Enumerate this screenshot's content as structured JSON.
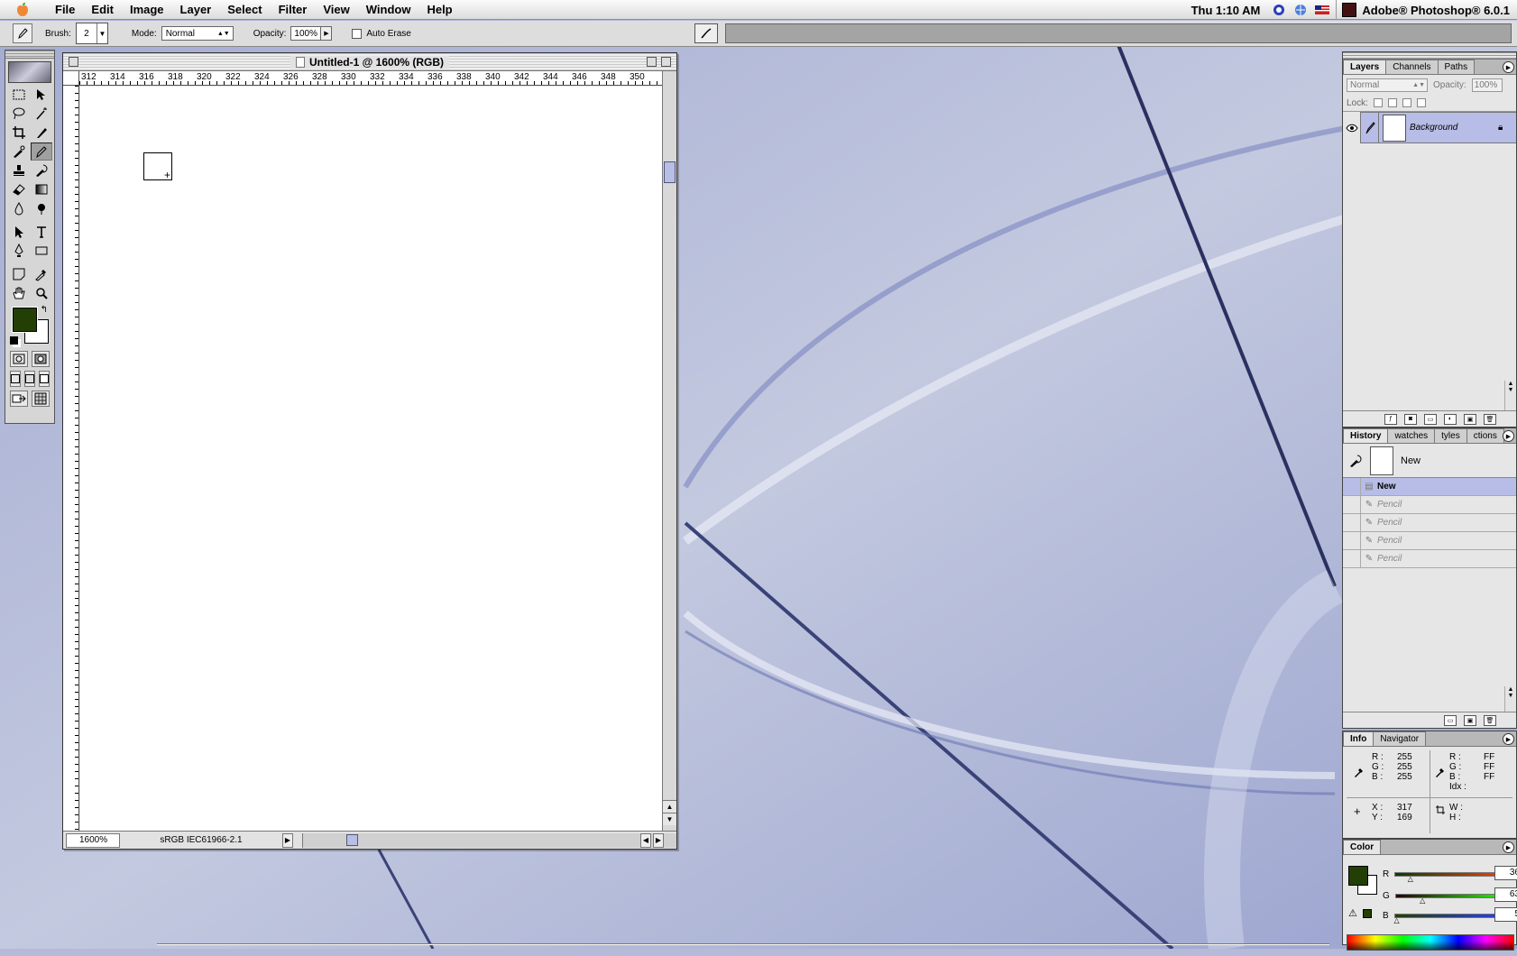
{
  "menubar": {
    "items": [
      "File",
      "Edit",
      "Image",
      "Layer",
      "Select",
      "Filter",
      "View",
      "Window",
      "Help"
    ],
    "clock": "Thu 1:10 AM",
    "app_name": "Adobe® Photoshop® 6.0.1"
  },
  "options": {
    "brush_label": "Brush:",
    "brush_size": "2",
    "mode_label": "Mode:",
    "mode_value": "Normal",
    "opacity_label": "Opacity:",
    "opacity_value": "100%",
    "auto_erase_label": "Auto Erase"
  },
  "document": {
    "title": "Untitled-1 @ 1600% (RGB)",
    "ruler_h": [
      "312",
      "314",
      "316",
      "318",
      "320",
      "322",
      "324",
      "326",
      "328",
      "330",
      "332",
      "334",
      "336",
      "338",
      "340",
      "342",
      "344",
      "346",
      "348",
      "350"
    ],
    "zoom": "1600%",
    "profile": "sRGB IEC61966-2.1"
  },
  "layers": {
    "tabs": [
      "Layers",
      "Channels",
      "Paths"
    ],
    "blend_mode": "Normal",
    "opacity_label": "Opacity:",
    "opacity_value": "100%",
    "lock_label": "Lock:",
    "items": [
      {
        "name": "Background"
      }
    ]
  },
  "history": {
    "tabs": [
      "History",
      "watches",
      "tyles",
      "ctions"
    ],
    "snapshot_name": "New",
    "items": [
      {
        "name": "New"
      },
      {
        "name": "Pencil"
      },
      {
        "name": "Pencil"
      },
      {
        "name": "Pencil"
      },
      {
        "name": "Pencil"
      }
    ]
  },
  "info": {
    "tabs": [
      "Info",
      "Navigator"
    ],
    "rgb_left": {
      "r": "255",
      "g": "255",
      "b": "255"
    },
    "rgb_right": {
      "r": "FF",
      "g": "FF",
      "b": "FF"
    },
    "labels": {
      "r": "R :",
      "g": "G :",
      "b": "B :",
      "idx": "Idx :",
      "x": "X :",
      "y": "Y :",
      "w": "W :",
      "h": "H :"
    },
    "x": "317",
    "y": "169"
  },
  "color": {
    "tab": "Color",
    "labels": {
      "r": "R",
      "g": "G",
      "b": "B"
    },
    "r": "36",
    "g": "63",
    "b": "5",
    "r_fraction": 0.141,
    "g_fraction": 0.247,
    "b_fraction": 0.02,
    "foreground": "#243f05",
    "background": "#ffffff"
  },
  "colors": {
    "accent": "#b7bde6",
    "desktop": "#b4bad7"
  }
}
